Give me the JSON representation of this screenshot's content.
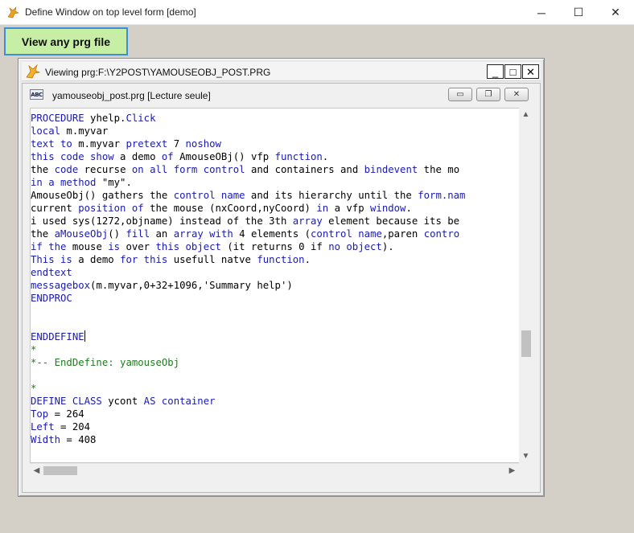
{
  "window": {
    "title": "Define Window on top level form [demo]",
    "minimize_glyph": "─",
    "maximize_glyph": "☐",
    "close_glyph": "✕"
  },
  "toolbar": {
    "view_button_label": "View any prg file"
  },
  "form": {
    "title": "Viewing prg:F:\\Y2POST\\YAMOUSEOBJ_POST.PRG",
    "minimize_glyph": "_",
    "maximize_glyph": "□",
    "close_glyph": "✕"
  },
  "editor_window": {
    "title": "yamouseobj_post.prg [Lecture seule]",
    "icon_label": "ABC",
    "minimize_glyph": "▭",
    "restore_glyph": "❐",
    "close_glyph": "✕"
  },
  "scrollbars": {
    "up_glyph": "▲",
    "down_glyph": "▼",
    "left_glyph": "◀",
    "right_glyph": "▶"
  },
  "code_lines": [
    [
      {
        "t": "PROCEDURE",
        "c": "kw"
      },
      {
        "t": " yhelp."
      },
      {
        "t": "Click",
        "c": "kw"
      }
    ],
    [
      {
        "t": "local",
        "c": "kw"
      },
      {
        "t": " m.myvar"
      }
    ],
    [
      {
        "t": "text to",
        "c": "kw"
      },
      {
        "t": " m.myvar "
      },
      {
        "t": "pretext",
        "c": "kw"
      },
      {
        "t": " 7 "
      },
      {
        "t": "noshow",
        "c": "kw"
      }
    ],
    [
      {
        "t": "this code show",
        "c": "kw"
      },
      {
        "t": " a demo "
      },
      {
        "t": "of",
        "c": "kw"
      },
      {
        "t": " AmouseOBj() vfp "
      },
      {
        "t": "function",
        "c": "kw"
      },
      {
        "t": "."
      }
    ],
    [
      {
        "t": "the "
      },
      {
        "t": "code",
        "c": "kw"
      },
      {
        "t": " recurse "
      },
      {
        "t": "on all form control",
        "c": "kw"
      },
      {
        "t": " and containers and "
      },
      {
        "t": "bindevent",
        "c": "kw"
      },
      {
        "t": " the mo"
      }
    ],
    [
      {
        "t": "in a method",
        "c": "kw"
      },
      {
        "t": " \"my\"."
      }
    ],
    [
      {
        "t": "AmouseObj() gathers the "
      },
      {
        "t": "control name",
        "c": "kw"
      },
      {
        "t": " and its hierarchy until the "
      },
      {
        "t": "form.nam",
        "c": "kw"
      }
    ],
    [
      {
        "t": "current "
      },
      {
        "t": "position of",
        "c": "kw"
      },
      {
        "t": " the mouse (nxCoord,nyCoord) "
      },
      {
        "t": "in",
        "c": "kw"
      },
      {
        "t": " a vfp "
      },
      {
        "t": "window",
        "c": "kw"
      },
      {
        "t": "."
      }
    ],
    [
      {
        "t": "i used sys(1272,objname) instead of the 3th "
      },
      {
        "t": "array",
        "c": "kw"
      },
      {
        "t": " element because its be"
      }
    ],
    [
      {
        "t": "the "
      },
      {
        "t": "aMouseObj",
        "c": "kw"
      },
      {
        "t": "() "
      },
      {
        "t": "fill",
        "c": "kw"
      },
      {
        "t": " an "
      },
      {
        "t": "array with",
        "c": "kw"
      },
      {
        "t": " 4 elements ("
      },
      {
        "t": "control name",
        "c": "kw"
      },
      {
        "t": ",paren "
      },
      {
        "t": "contro",
        "c": "kw"
      }
    ],
    [
      {
        "t": "if the",
        "c": "kw"
      },
      {
        "t": " mouse "
      },
      {
        "t": "is",
        "c": "kw"
      },
      {
        "t": " over "
      },
      {
        "t": "this object",
        "c": "kw"
      },
      {
        "t": " (it returns 0 if "
      },
      {
        "t": "no object",
        "c": "kw"
      },
      {
        "t": ")."
      }
    ],
    [
      {
        "t": "This is",
        "c": "kw"
      },
      {
        "t": " a demo "
      },
      {
        "t": "for this",
        "c": "kw"
      },
      {
        "t": " usefull natve "
      },
      {
        "t": "function",
        "c": "kw"
      },
      {
        "t": "."
      }
    ],
    [
      {
        "t": "endtext",
        "c": "kw"
      }
    ],
    [
      {
        "t": "messagebox",
        "c": "kw"
      },
      {
        "t": "(m.myvar,0+32+1096,'Summary help')"
      }
    ],
    [
      {
        "t": "ENDPROC",
        "c": "kw"
      }
    ],
    [],
    [],
    [
      {
        "t": "ENDDEFINE",
        "c": "kw"
      },
      {
        "caret": true
      }
    ],
    [
      {
        "t": "*",
        "c": "cm"
      }
    ],
    [
      {
        "t": "*-- EndDefine: yamouseObj",
        "c": "cm"
      }
    ],
    [],
    [
      {
        "t": "*",
        "c": "cm"
      }
    ],
    [
      {
        "t": "DEFINE CLASS",
        "c": "kw"
      },
      {
        "t": " ycont "
      },
      {
        "t": "AS container",
        "c": "kw"
      }
    ],
    [
      {
        "t": "Top",
        "c": "kw"
      },
      {
        "t": " = 264"
      }
    ],
    [
      {
        "t": "Left",
        "c": "kw"
      },
      {
        "t": " = 204"
      }
    ],
    [
      {
        "t": "Width",
        "c": "kw"
      },
      {
        "t": " = 408"
      }
    ]
  ]
}
